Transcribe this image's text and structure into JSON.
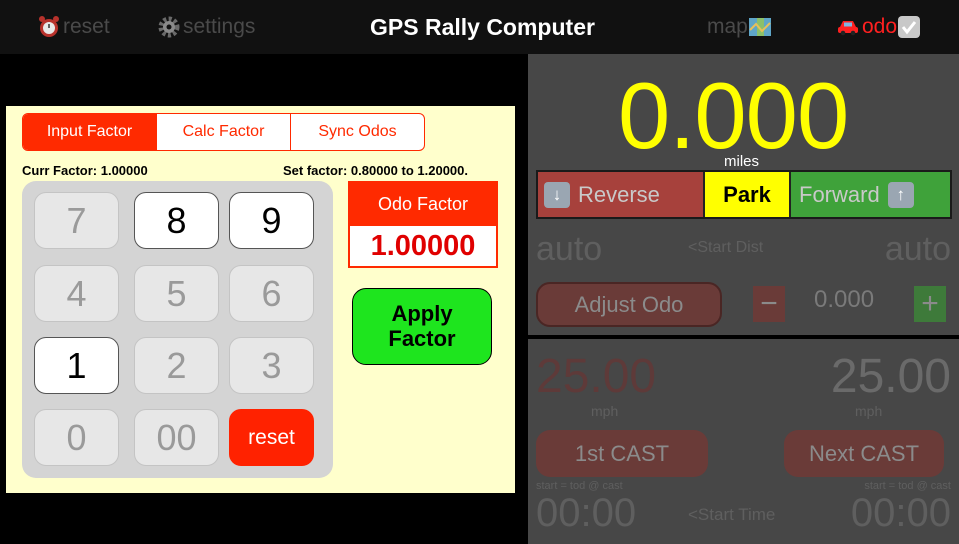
{
  "topbar": {
    "reset_label": "reset",
    "settings_label": "settings",
    "title": "GPS Rally Computer",
    "map_label": "map",
    "odo_label": "odo"
  },
  "left_panel": {
    "tabs": [
      {
        "label": "Input Factor",
        "active": true
      },
      {
        "label": "Calc Factor",
        "active": false
      },
      {
        "label": "Sync Odos",
        "active": false
      }
    ],
    "curr_factor": "Curr Factor: 1.00000",
    "set_factor_range": "Set factor: 0.80000 to 1.20000.",
    "keypad": {
      "keys": [
        {
          "label": "7",
          "enabled": false
        },
        {
          "label": "8",
          "enabled": true
        },
        {
          "label": "9",
          "enabled": true
        },
        {
          "label": "4",
          "enabled": false
        },
        {
          "label": "5",
          "enabled": false
        },
        {
          "label": "6",
          "enabled": false
        },
        {
          "label": "1",
          "enabled": true
        },
        {
          "label": "2",
          "enabled": false
        },
        {
          "label": "3",
          "enabled": false
        },
        {
          "label": "0",
          "enabled": false
        },
        {
          "label": "00",
          "enabled": false
        },
        {
          "label": "reset",
          "enabled": true
        }
      ]
    },
    "odo_factor_label": "Odo Factor",
    "odo_factor_value": "1.00000",
    "apply_factor_line1": "Apply",
    "apply_factor_line2": "Factor"
  },
  "odometer": {
    "value": "0.000",
    "units": "miles",
    "reverse_label": "Reverse",
    "park_label": "Park",
    "forward_label": "Forward",
    "auto_left": "auto",
    "start_dist": "<Start Dist",
    "auto_right": "auto",
    "adjust_odo_label": "Adjust Odo",
    "minus_label": "−",
    "adjust_value": "0.000",
    "plus_label": "+"
  },
  "cast": {
    "speed_left": "25.00",
    "speed_right": "25.00",
    "mph_left": "mph",
    "mph_right": "mph",
    "first_cast_label": "1st CAST",
    "next_cast_label": "Next CAST",
    "start_tod_left": "start = tod @ cast",
    "start_tod_right": "start = tod @ cast",
    "time_left": "00:00",
    "start_time": "<Start Time",
    "time_right": "00:00"
  },
  "colors": {
    "accent_red": "#ff2a00",
    "odometer_yellow": "#ffff00",
    "apply_green": "#1ee51e",
    "panel_bg": "#ffffcc",
    "right_panel_bg": "#474747"
  },
  "icons": {
    "reset": "alarm-clock-icon",
    "settings": "gear-icon",
    "map": "map-icon",
    "odo": "car-icon",
    "odo_check": "checkbox-checked-icon",
    "reverse": "arrow-down-icon",
    "forward": "arrow-up-icon"
  }
}
